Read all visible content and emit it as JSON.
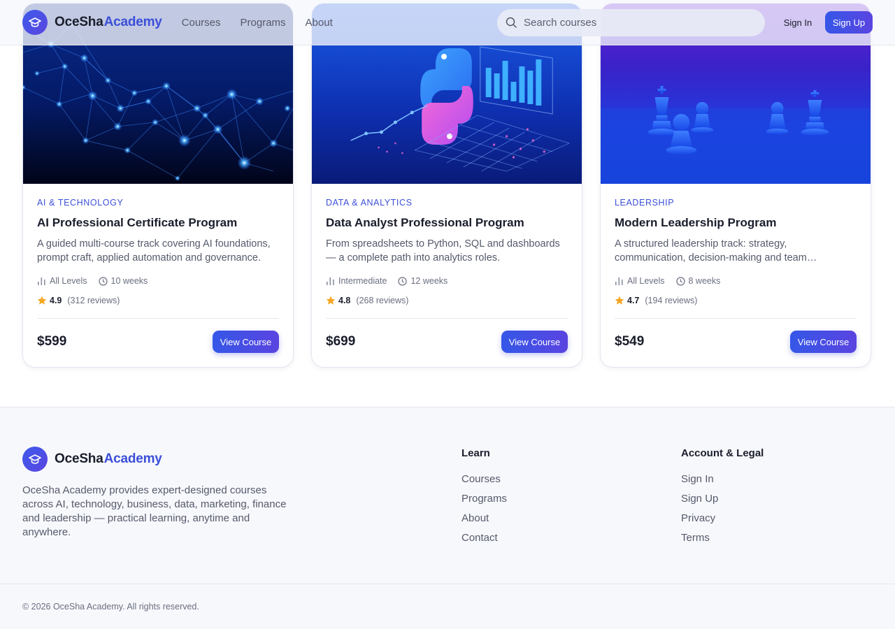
{
  "header": {
    "brand_part1": "OceSha",
    "brand_part2": "Academy",
    "nav": [
      {
        "label": "Courses"
      },
      {
        "label": "Programs"
      },
      {
        "label": "About"
      }
    ],
    "search_placeholder": "Search courses",
    "signin_label": "Sign In",
    "signup_label": "Sign Up"
  },
  "cards": [
    {
      "category": "AI & TECHNOLOGY",
      "title": "AI Professional Certificate Program",
      "description": "A guided multi-course track covering AI foundations, prompt craft, applied automation and governance.",
      "level": "All Levels",
      "duration": "10 weeks",
      "rating": "4.9",
      "reviews": "(312 reviews)",
      "price": "$599",
      "button": "View Course",
      "image": "ai-network-image"
    },
    {
      "category": "DATA & ANALYTICS",
      "title": "Data Analyst Professional Program",
      "description": "From spreadsheets to Python, SQL and dashboards — a complete path into analytics roles.",
      "level": "Intermediate",
      "duration": "12 weeks",
      "rating": "4.8",
      "reviews": "(268 reviews)",
      "price": "$699",
      "button": "View Course",
      "image": "python-analytics-image"
    },
    {
      "category": "LEADERSHIP",
      "title": "Modern Leadership Program",
      "description": "A structured leadership track: strategy, communication, decision-making and team leadership.",
      "level": "All Levels",
      "duration": "8 weeks",
      "rating": "4.7",
      "reviews": "(194 reviews)",
      "price": "$549",
      "button": "View Course",
      "image": "chess-pieces-image"
    }
  ],
  "footer": {
    "brand_part1": "OceSha",
    "brand_part2": "Academy",
    "description": "OceSha Academy provides expert-designed courses across AI, technology, business, data, marketing, finance and leadership — practical learning, anytime and anywhere.",
    "learn_heading": "Learn",
    "learn_links": [
      {
        "label": "Courses"
      },
      {
        "label": "Programs"
      },
      {
        "label": "About"
      },
      {
        "label": "Contact"
      }
    ],
    "account_heading": "Account & Legal",
    "account_links": [
      {
        "label": "Sign In"
      },
      {
        "label": "Sign Up"
      },
      {
        "label": "Privacy"
      },
      {
        "label": "Terms"
      }
    ],
    "copyright": "© 2026 OceSha Academy. All rights reserved."
  },
  "colors": {
    "accent": "#3b4fd8",
    "button_gradient_start": "#3557e8",
    "button_gradient_end": "#5a44e0",
    "star": "#f5a623",
    "text_primary": "#1a1d2b",
    "text_secondary": "#555a6b"
  },
  "icons": {
    "logo": "graduation-cap-icon",
    "search": "search-icon",
    "level": "bar-chart-icon",
    "duration": "clock-icon",
    "rating": "star-icon"
  }
}
